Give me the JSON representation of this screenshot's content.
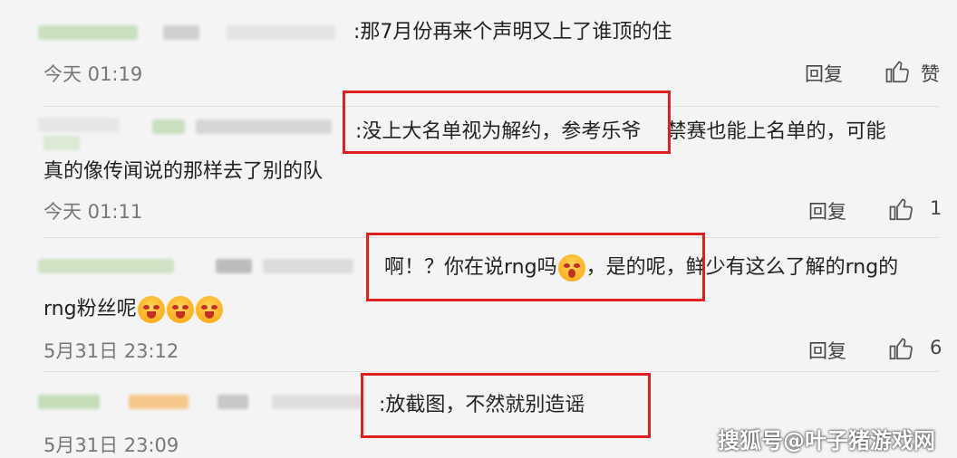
{
  "comments": [
    {
      "name_suffix": ":",
      "text": "那7月份再来个声明又上了谁顶的住",
      "time": "今天 01:19",
      "reply": "回复",
      "likes": "赞"
    },
    {
      "name_suffix": ":",
      "boxed_text": "没上大名单视为解约，参考乐爷",
      "text_rest": "禁赛也能上名单的，可能",
      "text_line2": "真的像传闻说的那样去了别的队",
      "time": "今天 01:11",
      "reply": "回复",
      "likes": "1"
    },
    {
      "boxed_pre": "啊！？你在说rng吗",
      "boxed_post": "，是的呢，",
      "text_rest": "鲜少有这么了解的rng的",
      "text_line2_pre": "rng粉丝呢",
      "time": "5月31日 23:12",
      "reply": "回复",
      "likes": "6"
    },
    {
      "name_suffix": ":",
      "boxed_text": "放截图，不然就别造谣",
      "time": "5月31日 23:09"
    }
  ],
  "watermark": "搜狐号@叶子猪游戏网",
  "colors": {
    "highlight_box": "#e02020",
    "background": "#f4f4f4"
  },
  "icons": {
    "like": "thumbs-up-icon",
    "emoji_laugh": "laughing-emoji-icon",
    "emoji_shock": "shocked-emoji-icon"
  }
}
